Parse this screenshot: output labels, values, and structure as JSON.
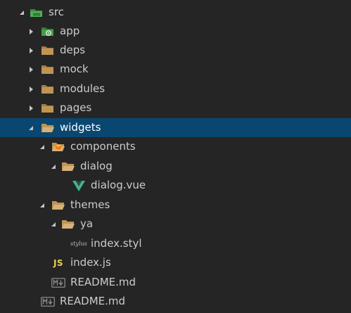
{
  "explorer": {
    "items": [
      {
        "label": "src",
        "type": "folder-open",
        "icon": "src-folder-icon"
      },
      {
        "label": "app",
        "type": "folder-closed",
        "icon": "app-folder-icon"
      },
      {
        "label": "deps",
        "type": "folder-closed",
        "icon": "folder-icon"
      },
      {
        "label": "mock",
        "type": "folder-closed",
        "icon": "folder-icon"
      },
      {
        "label": "modules",
        "type": "folder-closed",
        "icon": "folder-icon"
      },
      {
        "label": "pages",
        "type": "folder-closed",
        "icon": "folder-icon"
      },
      {
        "label": "widgets",
        "type": "folder-open",
        "icon": "folder-open-icon",
        "selected": true
      },
      {
        "label": "components",
        "type": "folder-open",
        "icon": "components-folder-icon"
      },
      {
        "label": "dialog",
        "type": "folder-open",
        "icon": "folder-open-icon"
      },
      {
        "label": "dialog.vue",
        "type": "file",
        "icon": "vue-icon"
      },
      {
        "label": "themes",
        "type": "folder-open",
        "icon": "folder-open-icon"
      },
      {
        "label": "ya",
        "type": "folder-open",
        "icon": "folder-open-icon"
      },
      {
        "label": "index.styl",
        "type": "file",
        "icon": "stylus-icon"
      },
      {
        "label": "index.js",
        "type": "file",
        "icon": "js-icon"
      },
      {
        "label": "README.md",
        "type": "file",
        "icon": "markdown-icon"
      },
      {
        "label": "README.md",
        "type": "file",
        "icon": "markdown-icon"
      }
    ],
    "icon_text": {
      "js": "JS",
      "stylus": "stylus"
    }
  },
  "colors": {
    "background": "#252526",
    "selection": "#094771",
    "folder": "#c09553",
    "vue": "#41b883",
    "js": "#e8d44d",
    "src_folder": "#4caf50"
  }
}
